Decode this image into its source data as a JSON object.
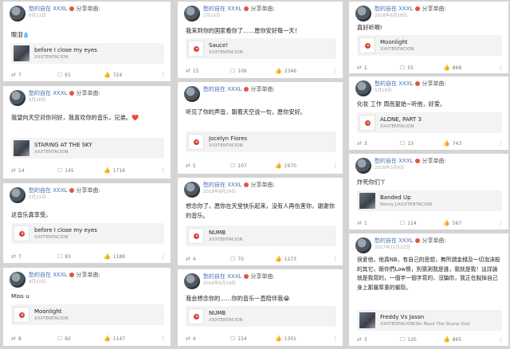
{
  "user": {
    "name": "愁的自在 XXXL",
    "share_label": "分享单曲:"
  },
  "icons": {
    "repost": "repost-icon",
    "comment": "comment-icon",
    "like": "thumbs-up-icon",
    "more": "more-icon",
    "badge": "verified-badge-icon",
    "play": "play-icon"
  },
  "columns": [
    {
      "cards": [
        {
          "date": "6月11日",
          "text": "眼泪💧",
          "song": "before I close my eyes",
          "artist": "XXXTENTACION",
          "repost": "7",
          "comment": "61",
          "like": "724"
        },
        {
          "date": "5月28日",
          "text": "我望向天空对你问好，我喜欢你的音乐，兄弟。❤️",
          "song": "STARING AT THE SKY",
          "artist": "XXXTENTACION",
          "repost": "14",
          "comment": "145",
          "like": "1719"
        },
        {
          "date": "5月21日",
          "text": "这音乐真享受。",
          "song": "before I close my eyes",
          "artist": "XXXTENTACION",
          "repost": "7",
          "comment": "83",
          "like": "1189"
        },
        {
          "date": "4月22日",
          "text": "Miss u",
          "song": "Moonlight",
          "artist": "XXXTENTACION",
          "repost": "8",
          "comment": "82",
          "like": "1147"
        }
      ]
    },
    {
      "cards": [
        {
          "date": "2月10日",
          "text": "我来到你的国家看你了……愿你安好每一天！",
          "song": "Sauce!",
          "artist": "XXXTENTACION",
          "repost": "15",
          "comment": "109",
          "like": "2346"
        },
        {
          "date": "",
          "text": "听见了你的声音，朝着天空说一句，愿你安好。",
          "song": "Jocelyn Flores",
          "artist": "XXXTENTACION",
          "repost": "5",
          "comment": "107",
          "like": "1970"
        },
        {
          "date": "2018年8月24日",
          "text": "想念你了，愿你在天堂快乐起来，没有人再伤害你，谢谢你的音乐。",
          "song": "NUMB",
          "artist": "XXXTENTACION",
          "repost": "4",
          "comment": "70",
          "like": "1273"
        },
        {
          "date": "2018年6月19日",
          "text": "我会想念你的……你的音乐一直陪伴我😭",
          "song": "NUMB",
          "artist": "XXXTENTACION",
          "repost": "4",
          "comment": "154",
          "like": "1301"
        }
      ]
    },
    {
      "cards": [
        {
          "date": "2018年6月18日",
          "text": "真好听啊!",
          "song": "Moonlight",
          "artist": "XXXTENTACION",
          "repost": "1",
          "comment": "55",
          "like": "868"
        },
        {
          "date": "5月18日",
          "text": "化妆 工作 周而复始~听他，好爱。",
          "song": "ALONE, PART 3",
          "artist": "XXXTENTACION",
          "repost": "3",
          "comment": "13",
          "like": "743"
        },
        {
          "date": "2018年3月8日",
          "text": "炸死你们丫",
          "song": "Banded Up",
          "artist": "Ronny J/XXXTENTACION",
          "repost": "1",
          "comment": "114",
          "like": "567"
        },
        {
          "date": "2017年11月22日",
          "text": "很爱他，他真NB，有自己的思想，無所謂金錢及一切泡沫般的其它，跟你們Low擦，別猜測我是誰，我就是我！這詳論就是我寫的，一個字一個字寫的，沒騙你，我正在脫掉自己身上那層厚重的軀殼。",
          "song": "Freddy Vs Jason",
          "artist": "XXXTENTACION/Ski Mask The Slump God",
          "repost": "3",
          "comment": "120",
          "like": "865"
        }
      ]
    }
  ]
}
